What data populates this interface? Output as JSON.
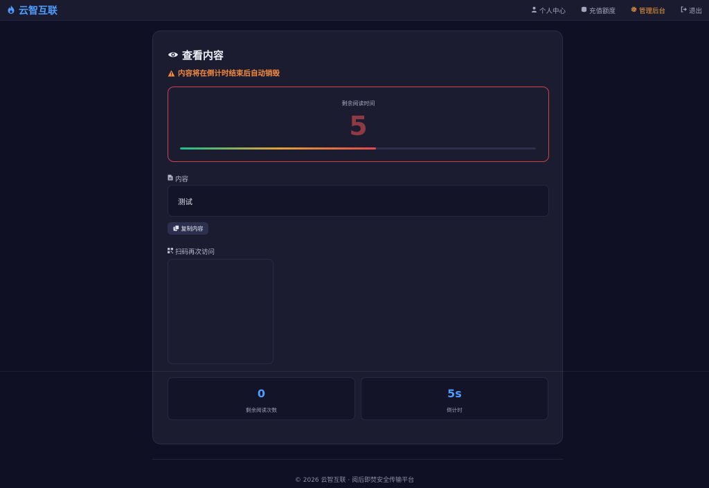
{
  "brand": {
    "name": "云智互联"
  },
  "nav": [
    {
      "label": "个人中心",
      "icon": "user-icon"
    },
    {
      "label": "充值额度",
      "icon": "coins-icon"
    },
    {
      "label": "管理后台",
      "icon": "gear-icon",
      "active": true
    },
    {
      "label": "退出",
      "icon": "logout-icon"
    }
  ],
  "card": {
    "title": "查看内容",
    "warning": "内容将在倒计时结束后自动销毁",
    "timer": {
      "label": "剩余阅读时间",
      "value": "5",
      "progress_fraction": 0.55
    },
    "content": {
      "label": "内容",
      "text": "测试"
    },
    "copy_button": "复制内容",
    "qr_label": "扫码再次访问",
    "stats": [
      {
        "value": "0",
        "label": "剩余阅读次数"
      },
      {
        "value": "5s",
        "label": "倒计时"
      }
    ]
  },
  "footer": {
    "text": "© 2026 云智互联 · 阅后即焚安全传输平台"
  },
  "colors": {
    "accent": "#4f9cff",
    "warning": "#f0883e",
    "danger_border": "#d0424c",
    "background": "#0f1023"
  }
}
